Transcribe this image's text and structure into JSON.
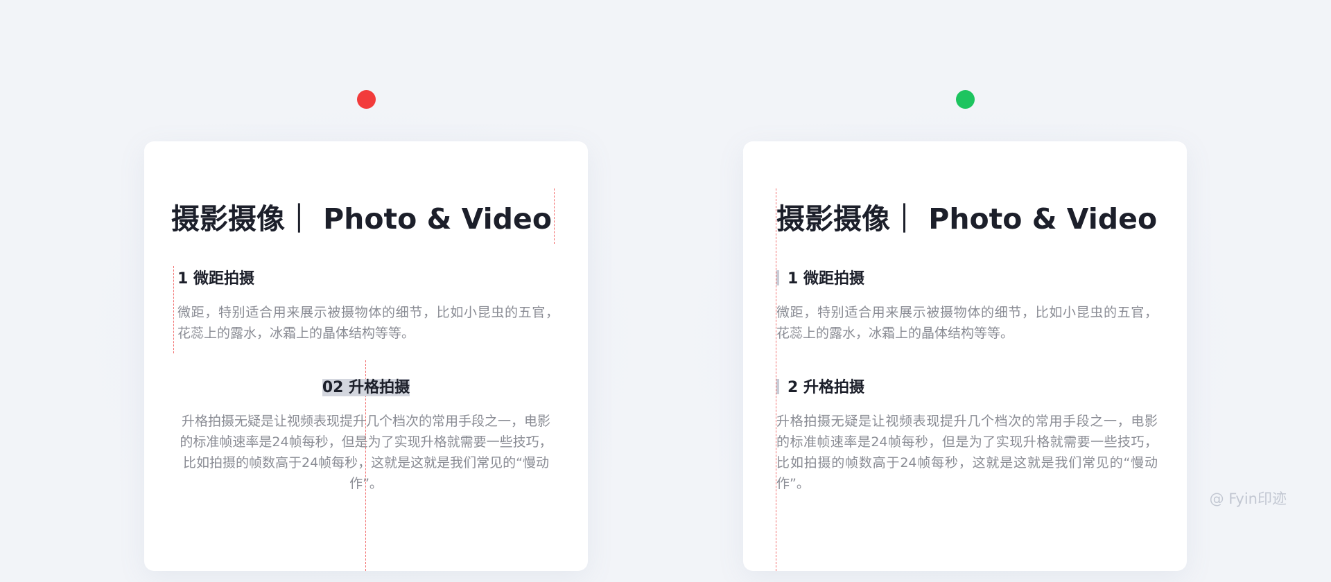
{
  "colors": {
    "bad_indicator": "#f23b3b",
    "good_indicator": "#1dc45f",
    "guide_line": "#f26d6d",
    "title_text": "#1c1f2a",
    "body_text": "#8a8c94"
  },
  "panels": [
    {
      "indicator": "red",
      "title": "摄影摄像｜ Photo & Video",
      "section1_title": "1 微距拍摄",
      "section1_body": "微距，特别适合用来展示被摄物体的细节，比如小昆虫的五官，花蕊上的露水，冰霜上的晶体结构等等。",
      "section2_title": "02 升格拍摄",
      "section2_body": "升格拍摄无疑是让视频表现提升几个档次的常用手段之一，电影的标准帧速率是24帧每秒，但是为了实现升格就需要一些技巧，比如拍摄的帧数高于24帧每秒，这就是这就是我们常见的“慢动作”。"
    },
    {
      "indicator": "green",
      "title": "摄影摄像｜ Photo & Video",
      "section1_title": "1 微距拍摄",
      "section1_body": "微距，特别适合用来展示被摄物体的细节，比如小昆虫的五官，花蕊上的露水，冰霜上的晶体结构等等。",
      "section2_title": "2 升格拍摄",
      "section2_body": "升格拍摄无疑是让视频表现提升几个档次的常用手段之一，电影的标准帧速率是24帧每秒，但是为了实现升格就需要一些技巧，比如拍摄的帧数高于24帧每秒，这就是这就是我们常见的“慢动作”。"
    }
  ],
  "watermark": "@ Fyin印迹"
}
